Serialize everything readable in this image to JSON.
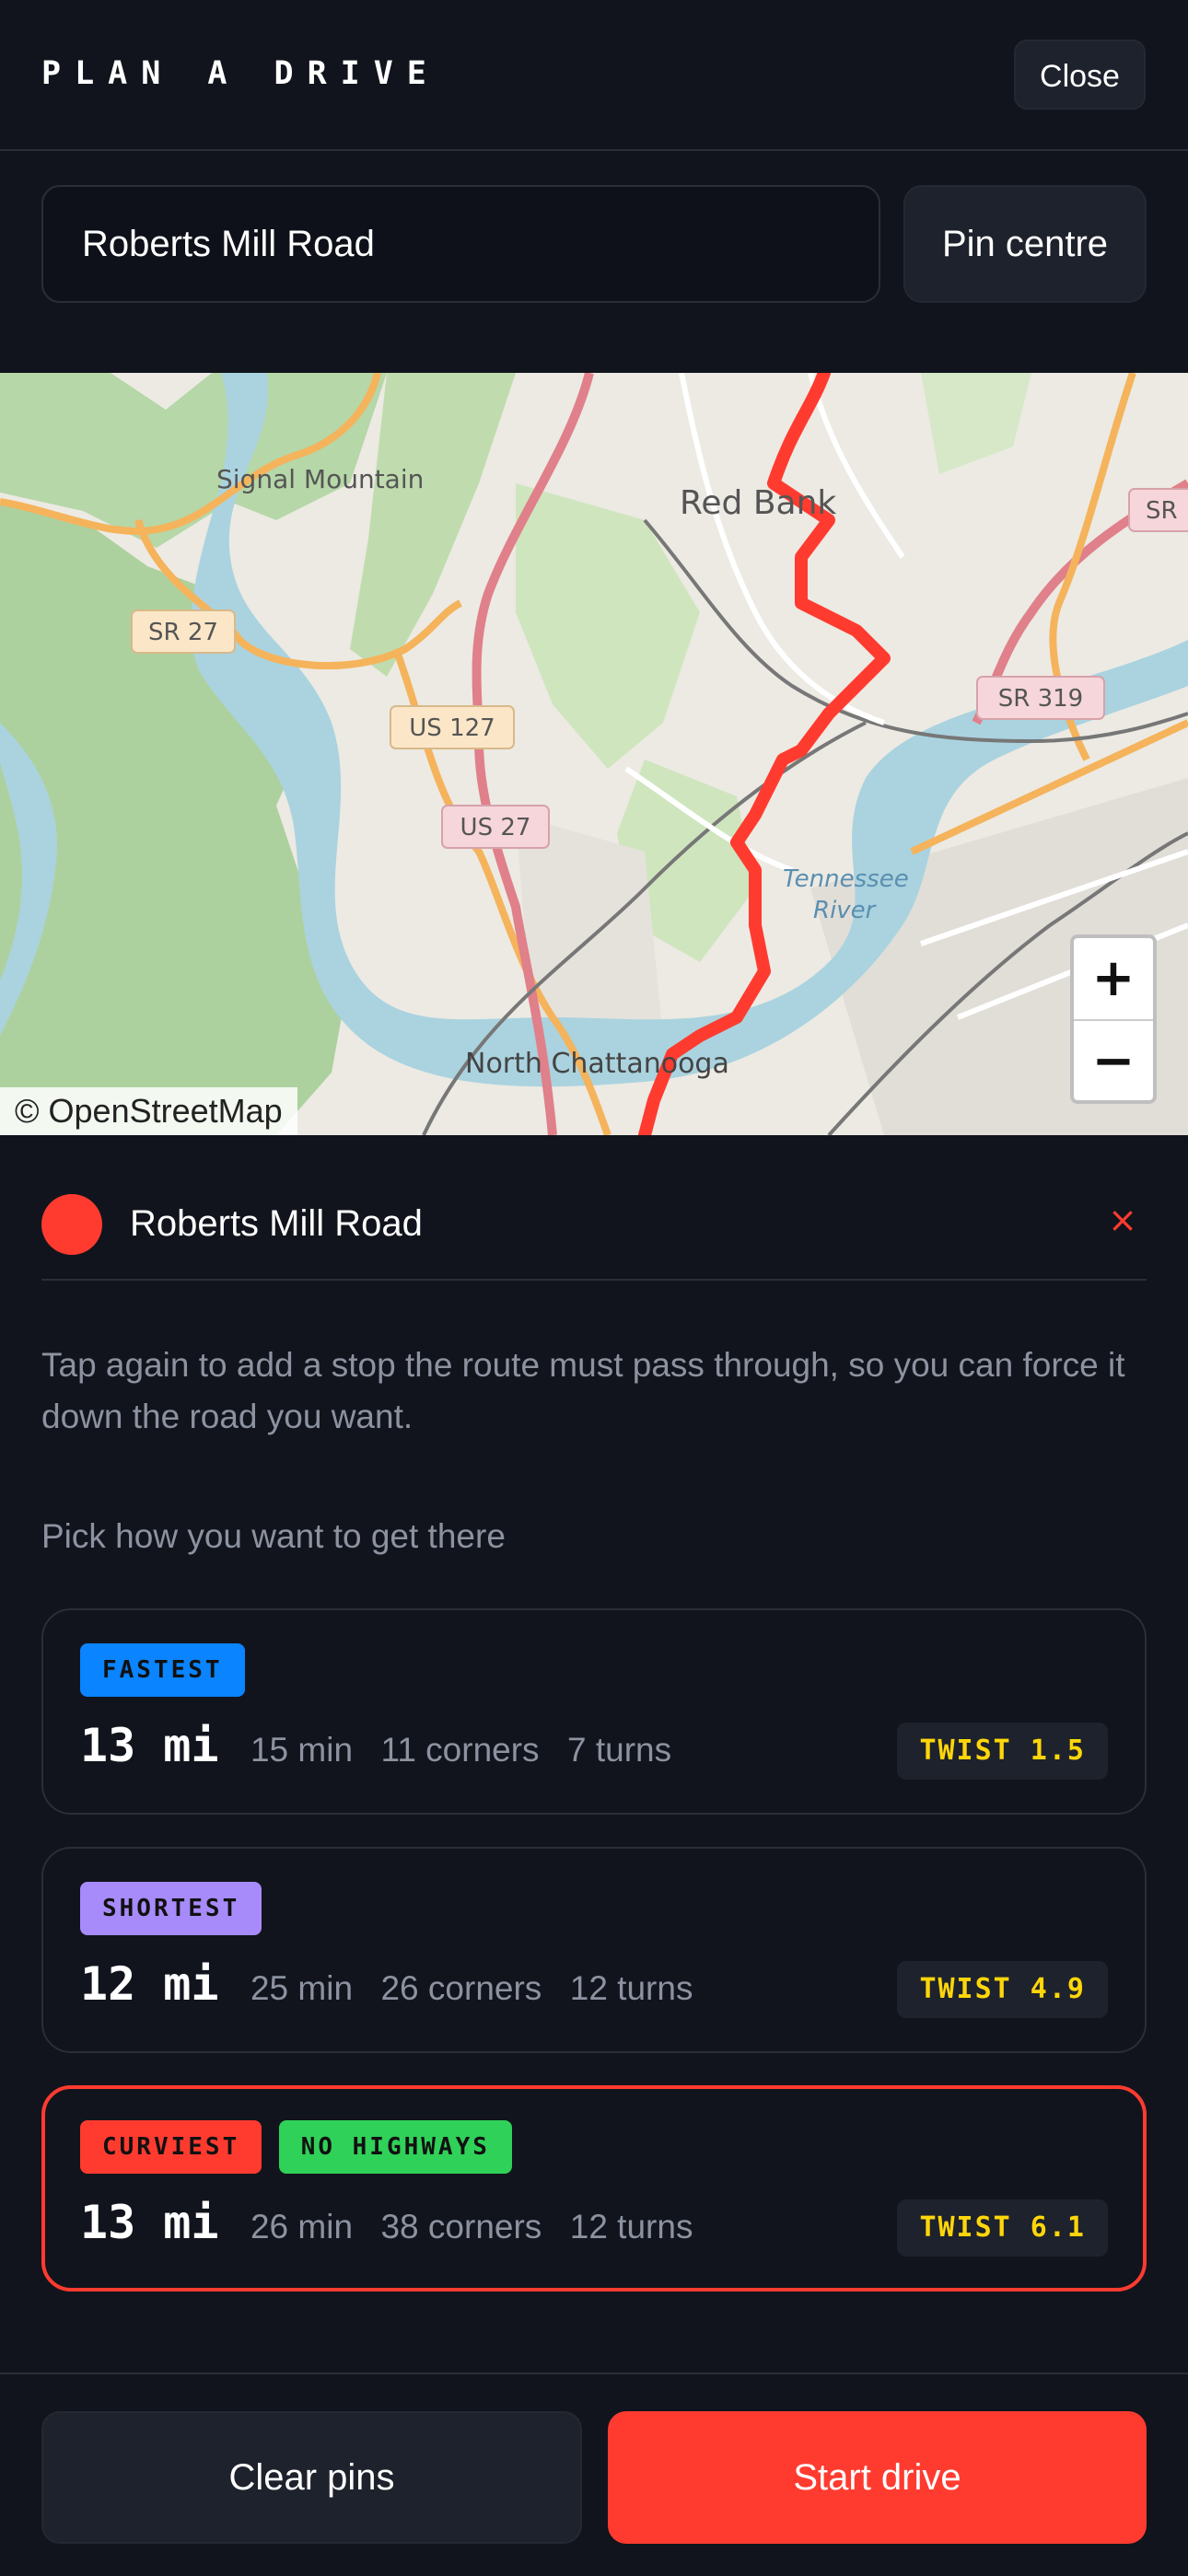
{
  "header": {
    "title": "PLAN A DRIVE",
    "close_label": "Close"
  },
  "search": {
    "value": "Roberts Mill Road",
    "pin_centre_label": "Pin centre"
  },
  "map": {
    "attribution": "© OpenStreetMap",
    "place_labels": [
      "Signal Mountain",
      "Red Bank",
      "North Chattanooga"
    ],
    "water_labels": [
      "Tennessee",
      "River"
    ],
    "road_shields": [
      "SR 27",
      "US 127",
      "US 27",
      "SR 319",
      "SR"
    ],
    "zoom_in_label": "+",
    "zoom_out_label": "−",
    "route_color": "#ff3b30"
  },
  "pin": {
    "name": "Roberts Mill Road",
    "remove_label": "×",
    "color": "#ff3b30"
  },
  "hint": "Tap again to add a stop the route must pass through, so you can force it down the road you want.",
  "routes_heading": "Pick how you want to get there",
  "routes": [
    {
      "tags": [
        {
          "label": "FASTEST",
          "color": "#0a84ff"
        }
      ],
      "distance": "13 mi",
      "time": "15 min",
      "corners": "11 corners",
      "turns": "7 turns",
      "twist": "TWIST 1.5",
      "selected": false
    },
    {
      "tags": [
        {
          "label": "SHORTEST",
          "color": "#a78bfa"
        }
      ],
      "distance": "12 mi",
      "time": "25 min",
      "corners": "26 corners",
      "turns": "12 turns",
      "twist": "TWIST 4.9",
      "selected": false
    },
    {
      "tags": [
        {
          "label": "CURVIEST",
          "color": "#ff3b30"
        },
        {
          "label": "NO HIGHWAYS",
          "color": "#30d158"
        }
      ],
      "distance": "13 mi",
      "time": "26 min",
      "corners": "38 corners",
      "turns": "12 turns",
      "twist": "TWIST 6.1",
      "selected": true
    }
  ],
  "footer": {
    "clear_label": "Clear pins",
    "start_label": "Start drive"
  }
}
